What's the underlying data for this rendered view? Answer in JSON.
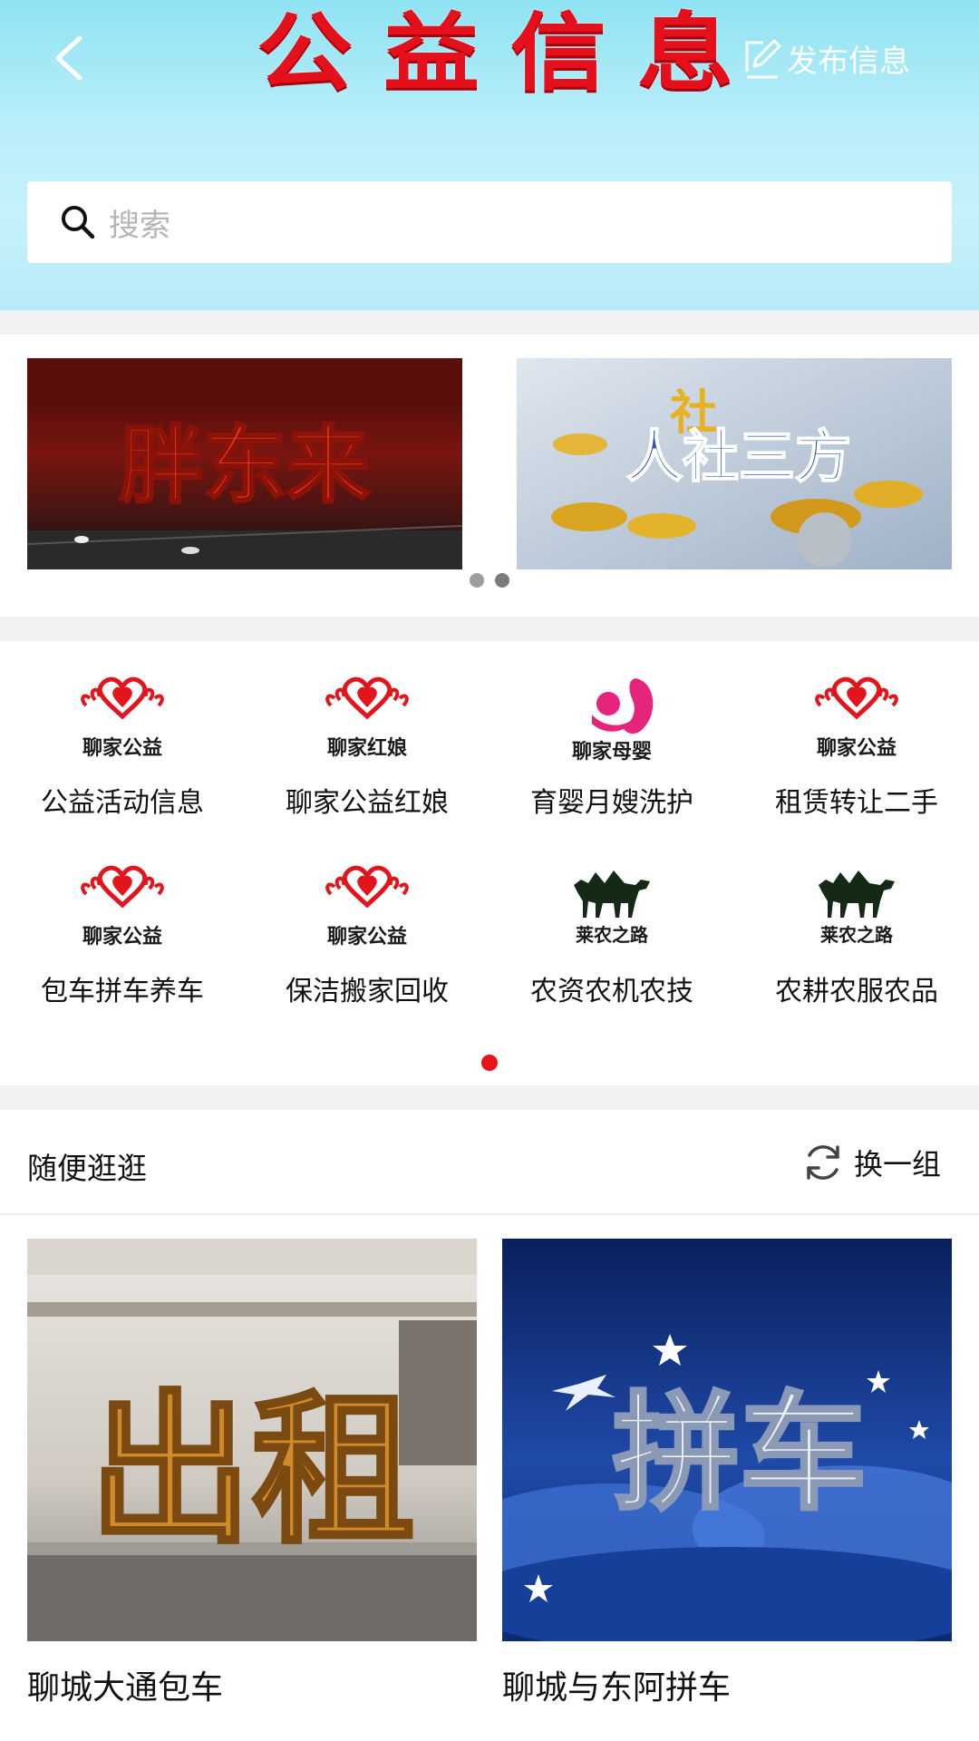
{
  "header": {
    "title": "公益信息",
    "publish_label": "发布信息",
    "back_icon": "chevron-left-icon",
    "publish_icon": "edit-icon"
  },
  "search": {
    "placeholder": "搜索",
    "icon": "search-icon"
  },
  "banners": [
    {
      "text": "胖东来"
    },
    {
      "text": "人社三方",
      "sub": "社"
    }
  ],
  "categories": [
    {
      "logo_text": "聊家公益",
      "label": "公益活动信息",
      "logo": "heart-logo"
    },
    {
      "logo_text": "聊家红娘",
      "label": "聊家公益红娘",
      "logo": "heart-logo"
    },
    {
      "logo_text": "聊家母婴",
      "label": "育婴月嫂洗护",
      "logo": "mother-baby-logo"
    },
    {
      "logo_text": "聊家公益",
      "label": "租赁转让二手",
      "logo": "heart-logo"
    },
    {
      "logo_text": "聊家公益",
      "label": "包车拼车养车",
      "logo": "heart-logo"
    },
    {
      "logo_text": "聊家公益",
      "label": "保洁搬家回收",
      "logo": "heart-logo"
    },
    {
      "logo_text": "莱农之路",
      "label": "农资农机农技",
      "logo": "camel-logo"
    },
    {
      "logo_text": "莱农之路",
      "label": "农耕农服农品",
      "logo": "camel-logo"
    }
  ],
  "browse": {
    "title": "随便逛逛",
    "refresh_label": "换一组",
    "refresh_icon": "refresh-icon",
    "items": [
      {
        "image_text": "出租",
        "title": "聊城大通包车"
      },
      {
        "image_text": "拼车",
        "title": "聊城与东阿拼车"
      }
    ]
  },
  "colors": {
    "accent": "#e8141c",
    "header_bg": "#b9eefa",
    "band": "#f1f1f1"
  }
}
